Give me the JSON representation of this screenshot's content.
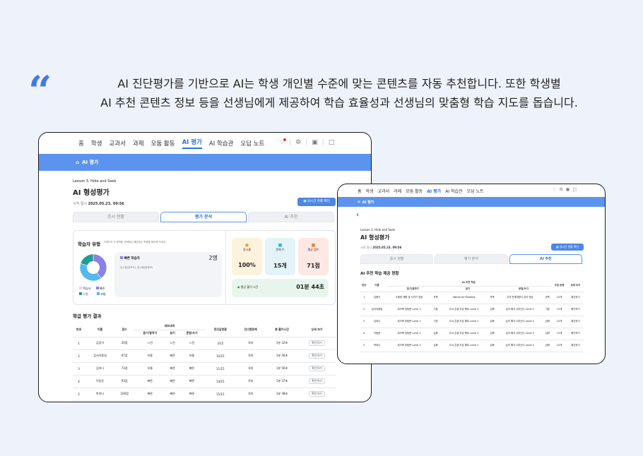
{
  "caption": {
    "line1": "AI 진단평가를 기반으로 AI는 학생 개인별 수준에 맞는 콘텐츠를 자동 추천합니다. 또한 학생별",
    "line2": "AI 추천 콘텐츠 정보 등을 선생님에게 제공하여 학습 효율성과 선생님의 맞춤형 학습 지도를 돕습니다."
  },
  "nav": {
    "items": [
      "홈",
      "학생",
      "교과서",
      "과제",
      "모둠 활동",
      "AI 평가",
      "AI 학습관",
      "오답 노트"
    ],
    "active": "AI 평가"
  },
  "header_bar": "AI 평가",
  "main": {
    "lesson": "Lesson 3. Hide and Seek",
    "title": "AI 형성평가",
    "start_label": "시작 일시",
    "start_value": "2025.05.23. 09:56",
    "realtime_button": "실시간 현황 확인",
    "tabs": [
      "응시 현황",
      "평가 분석",
      "AI 추천"
    ],
    "active_tab": "평가 분석",
    "type_title": "학습자 유형",
    "type_desc": "그래프의 각 영역을 선택해서 해당하는 학생을 확인해 보세요.",
    "selected_type": "빠른 학습자",
    "selected_count": "2명",
    "selected_names": "임시현(유보도), 임시현(문창모)",
    "legend": [
      "학습서",
      "빠른",
      "느린",
      "보통"
    ],
    "stats": [
      {
        "label": "응시율",
        "value": "100%"
      },
      {
        "label": "문제 수",
        "value": "15개"
      },
      {
        "label": "평균 점수",
        "value": "71점"
      }
    ],
    "avg_time_label": "평균 풀이 시간",
    "avg_time_value": "01분 44초",
    "results_title": "학급 평가 결과",
    "columns": {
      "no": "번호",
      "name": "이름",
      "score": "점수",
      "detail": "세부내역",
      "listen": "듣기/말하기",
      "read": "읽기",
      "write": "문법/쓰기",
      "correct": "정오답현황",
      "blank": "건너뛴문제",
      "time": "총 풀이시간",
      "view": "상세 보기"
    },
    "rows": [
      {
        "no": "1",
        "name": "김동이",
        "score": "20점",
        "listen": "느린",
        "read": "느린",
        "write": "느린",
        "correct": "3/15",
        "blank": "0개",
        "time": "1분 32초",
        "view": "확인하기"
      },
      {
        "no": "2",
        "name": "김서아중일",
        "score": "67점",
        "listen": "보통",
        "read": "빠른",
        "write": "보통",
        "correct": "10/15",
        "blank": "0개",
        "time": "1분 56초",
        "view": "확인하기"
      },
      {
        "no": "3",
        "name": "김하나",
        "score": "73점",
        "listen": "보통",
        "read": "빠른",
        "write": "빠른",
        "correct": "11/15",
        "blank": "0개",
        "time": "1분 56초",
        "view": "확인하기"
      },
      {
        "no": "4",
        "name": "이동준",
        "score": "93점",
        "listen": "빠른",
        "read": "빠른",
        "write": "빠른",
        "correct": "14/15",
        "blank": "0개",
        "time": "1분 37초",
        "view": "확인하기"
      },
      {
        "no": "5",
        "name": "박하나",
        "score": "100점",
        "listen": "빠른",
        "read": "빠른",
        "write": "빠른",
        "correct": "15/15",
        "blank": "0개",
        "time": "1분 38초",
        "view": "확인하기"
      }
    ]
  },
  "second": {
    "lesson": "Lesson 3. Hide and Seek",
    "title": "AI 형성평가",
    "start_label": "시작 일시",
    "start_value": "2025.05.23. 09:56",
    "realtime_button": "실시간 현황 확인",
    "tabs": [
      "응시 현황",
      "평가 분석",
      "AI 추천"
    ],
    "active_tab": "AI 추천",
    "section_title": "AI 추천 학습 제공 현황",
    "columns": {
      "no": "번호",
      "name": "이름",
      "group": "AI 추천 학습",
      "listen": "듣기/말하기",
      "read": "읽기",
      "write": "문법/쓰기",
      "review": "오답 문제",
      "view": "상세 보기"
    },
    "rows": [
      {
        "no": "1",
        "name": "김동이",
        "listen": "소중한 재활 및 사귀기 영상",
        "l_lv": "부족",
        "read": "Words for Reading",
        "r_lv": "부족",
        "write": "주격 관계대명사 강의 영상",
        "w_lv": "부족",
        "review": "15개",
        "view": "확인하기"
      },
      {
        "no": "2",
        "name": "김서아중일",
        "listen": "워크북 대등문 Level 1",
        "l_lv": "기본",
        "read": "도서 콘셉 도감 해트 Level 2",
        "r_lv": "심화",
        "write": "심의 예가 나타닌다 Level 1",
        "w_lv": "기본",
        "review": "15개",
        "view": "확인하기"
      },
      {
        "no": "3",
        "name": "김하나",
        "listen": "워크북 대등문 Level 1",
        "l_lv": "기본",
        "read": "도서 콘셉 도감 해트 Level 2",
        "r_lv": "심화",
        "write": "심의 예가 나타닌다 Level 2",
        "w_lv": "심화",
        "review": "15개",
        "view": "확인하기"
      },
      {
        "no": "4",
        "name": "이동준",
        "listen": "워크북 대등문 Level 2",
        "l_lv": "심화",
        "read": "도서 콘셉 도감 해트 Level 2",
        "r_lv": "심화",
        "write": "심의 예가 나타닌다 Level 2",
        "w_lv": "심화",
        "review": "15개",
        "view": "확인하기"
      },
      {
        "no": "5",
        "name": "박하나",
        "listen": "워크북 대등문 Level 2",
        "l_lv": "심화",
        "read": "도서 콘셉 도감 해트 Level 2",
        "r_lv": "심화",
        "write": "심의 예가 나타닌다 Level 2",
        "w_lv": "심화",
        "review": "15개",
        "view": "확인하기"
      }
    ]
  },
  "colors": {
    "accent": "#5b93ee",
    "brand": "#2f6fe4",
    "quote": "#3e7be8",
    "pie_fast": "#8b7fe8",
    "pie_normal": "#54b8f0",
    "pie_slow": "#1f9d8f"
  },
  "chart_data": {
    "type": "pie",
    "categories": [
      "빠른",
      "보통",
      "느린"
    ],
    "values": [
      2,
      2,
      1
    ]
  },
  "icons": [
    "quote-icon",
    "bell-icon",
    "gear-icon",
    "chat-icon",
    "document-icon",
    "home-icon",
    "back-icon"
  ]
}
